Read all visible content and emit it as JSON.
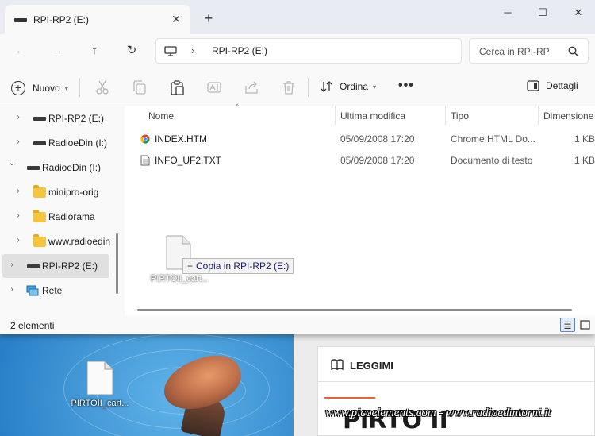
{
  "window": {
    "tab_title": "RPI-RP2 (E:)",
    "tab_close": "✕",
    "new_tab": "+",
    "minimize": "─",
    "maximize": "☐",
    "close": "✕"
  },
  "nav": {
    "back": "←",
    "forward": "→",
    "up": "↑",
    "refresh": "↻",
    "breadcrumb_sep": "›",
    "address": "RPI-RP2 (E:)",
    "search_placeholder": "Cerca in RPI-RP"
  },
  "toolbar": {
    "new_label": "Nuovo",
    "new_plus": "+",
    "caret": "▾",
    "sort_label": "Ordina",
    "more": "•••",
    "details_label": "Dettagli"
  },
  "sidebar": {
    "items": [
      {
        "label": "RPI-RP2 (E:)",
        "chevron": "›",
        "icon": "drive-icon"
      },
      {
        "label": "RadioeDin (I:)",
        "chevron": "›",
        "icon": "drive-icon"
      },
      {
        "label": "RadioeDin (I:)",
        "chevron": "⌄",
        "icon": "drive-icon"
      },
      {
        "label": "minipro-orig",
        "chevron": "›",
        "icon": "folder-icon"
      },
      {
        "label": "Radiorama",
        "chevron": "›",
        "icon": "folder-icon"
      },
      {
        "label": "www.radioedin",
        "chevron": "›",
        "icon": "folder-icon"
      },
      {
        "label": "RPI-RP2 (E:)",
        "chevron": "›",
        "icon": "drive-icon"
      },
      {
        "label": "Rete",
        "chevron": "›",
        "icon": "network-icon"
      }
    ]
  },
  "list": {
    "columns": [
      "Nome",
      "Ultima modifica",
      "Tipo",
      "Dimensione"
    ],
    "sort_indicator": "^",
    "rows": [
      {
        "name": "INDEX.HTM",
        "modified": "05/09/2008 17:20",
        "type": "Chrome HTML Do...",
        "size": "1 KB"
      },
      {
        "name": "INFO_UF2.TXT",
        "modified": "05/09/2008 17:20",
        "type": "Documento di testo",
        "size": "1 KB"
      }
    ]
  },
  "drag": {
    "file_label": "PIRTOII_cart...",
    "tip_plus": "+",
    "tip_text": "Copia in RPI-RP2 (E:)"
  },
  "status": {
    "count": "2 elementi"
  },
  "desktop": {
    "file_label": "PIRTOII_cart...",
    "webpage_tab": "LEGGIMI",
    "webpage_heading": "PiRTO II",
    "watermark": "www.picoelements.com - www.radioedintorni.it"
  },
  "colors": {
    "accent": "#e8623a",
    "folder": "#f3c542",
    "selection": "#e0e0e0"
  }
}
